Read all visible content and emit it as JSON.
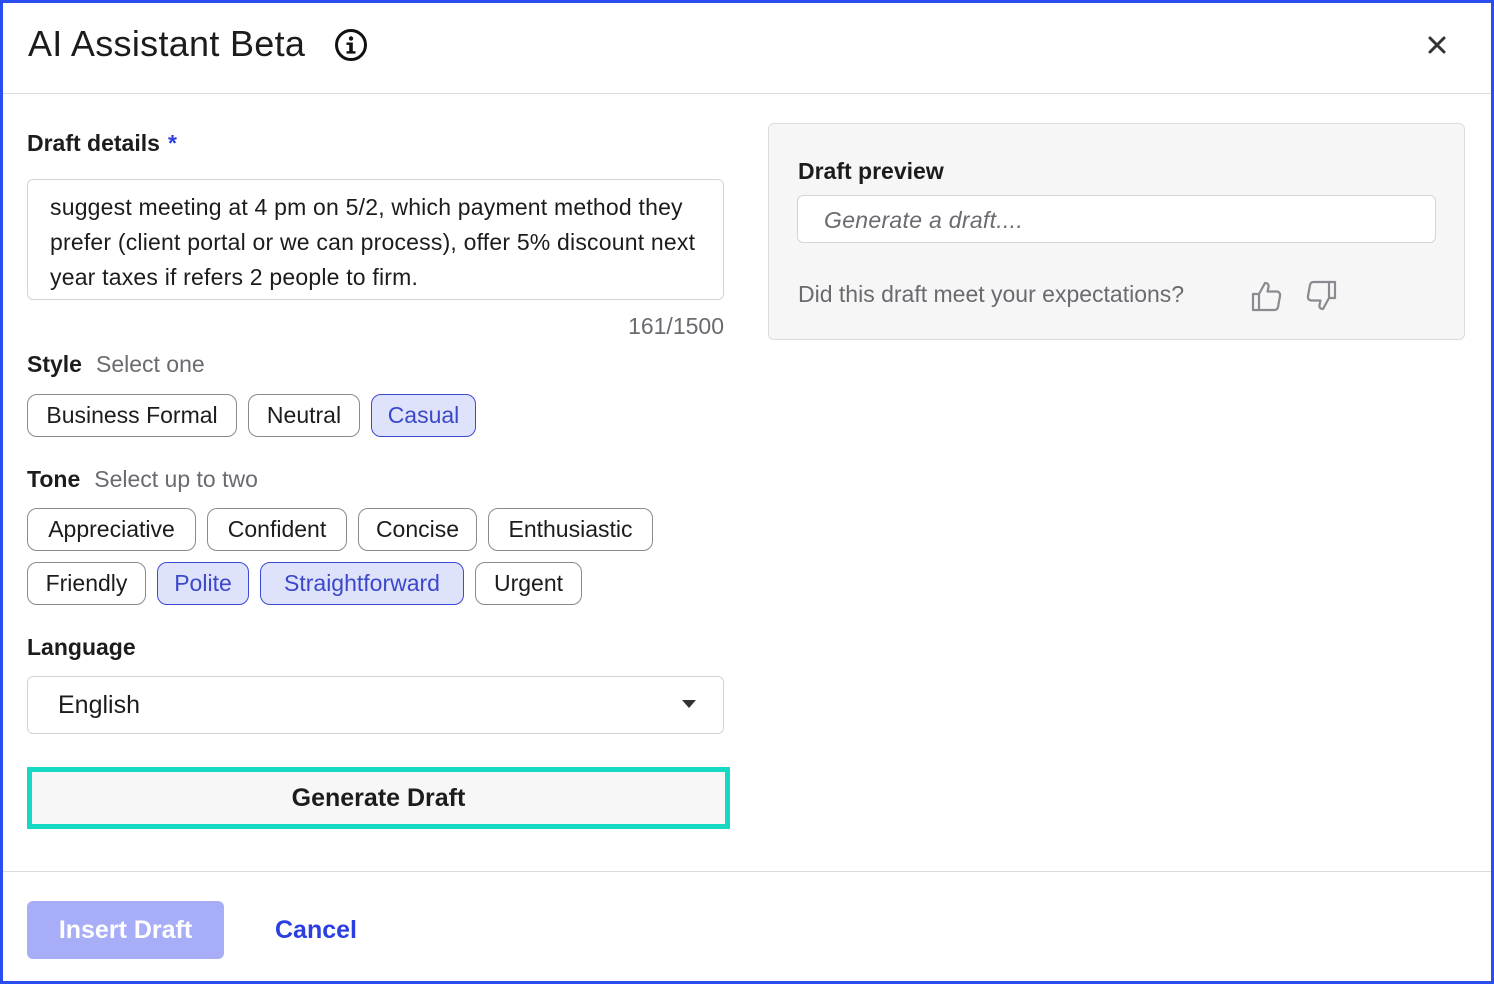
{
  "header": {
    "title": "AI Assistant Beta"
  },
  "draft_details": {
    "label": "Draft details",
    "required_mark": "*",
    "value": "suggest meeting at 4 pm on 5/2, which payment method they prefer (client portal or we can process), offer 5% discount next year taxes if refers 2 people to firm.",
    "counter": "161/1500"
  },
  "style": {
    "label": "Style",
    "hint": "Select one",
    "options": [
      {
        "label": "Business Formal",
        "selected": false
      },
      {
        "label": "Neutral",
        "selected": false
      },
      {
        "label": "Casual",
        "selected": true
      }
    ]
  },
  "tone": {
    "label": "Tone",
    "hint": "Select up to two",
    "options": [
      {
        "label": "Appreciative",
        "selected": false
      },
      {
        "label": "Confident",
        "selected": false
      },
      {
        "label": "Concise",
        "selected": false
      },
      {
        "label": "Enthusiastic",
        "selected": false
      },
      {
        "label": "Friendly",
        "selected": false
      },
      {
        "label": "Polite",
        "selected": true
      },
      {
        "label": "Straightforward",
        "selected": true
      },
      {
        "label": "Urgent",
        "selected": false
      }
    ]
  },
  "language": {
    "label": "Language",
    "selected": "English"
  },
  "generate_button": "Generate Draft",
  "preview": {
    "label": "Draft preview",
    "placeholder": "Generate a draft....",
    "feedback_question": "Did this draft meet your expectations?"
  },
  "footer": {
    "insert_label": "Insert Draft",
    "cancel_label": "Cancel"
  },
  "colors": {
    "accent": "#2b3fe0",
    "border": "#2b4ef0",
    "selected_chip_bg": "#dfe2fb",
    "highlight": "#16d9c4",
    "insert_disabled": "#a7aef7"
  },
  "icons": [
    "info-icon",
    "close-icon",
    "thumbs-up-icon",
    "thumbs-down-icon",
    "chevron-down-icon"
  ]
}
